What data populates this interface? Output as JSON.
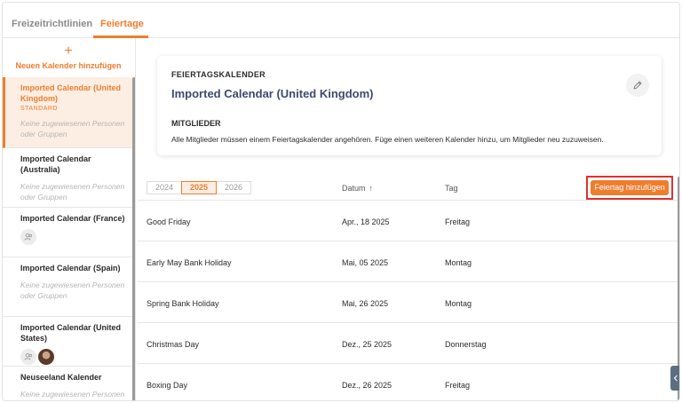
{
  "tabs": [
    {
      "label": "Freizeitrichtlinien"
    },
    {
      "label": "Feiertage"
    }
  ],
  "sidebar": {
    "add_label": "Neuen Kalender hinzufügen",
    "add_icon": "plus-icon",
    "calendars": [
      {
        "name": "Imported Calendar (United Kingdom)",
        "badge": "STANDARD",
        "members_text": "Keine zugewiesenen Personen oder Gruppen"
      },
      {
        "name": "Imported Calendar (Australia)",
        "members_text": "Keine zugewiesenen Personen oder Gruppen"
      },
      {
        "name": "Imported Calendar (France)"
      },
      {
        "name": "Imported Calendar (Spain)",
        "members_text": "Keine zugewiesenen Personen oder Gruppen"
      },
      {
        "name": "Imported Calendar (United States)"
      },
      {
        "name": "Neuseeland Kalender",
        "members_text": "Keine zugewiesenen Personen oder Gruppen"
      }
    ]
  },
  "card": {
    "heading": "FEIERTAGSKALENDER",
    "title": "Imported Calendar (United Kingdom)",
    "members_heading": "MITGLIEDER",
    "members_text": "Alle Mitglieder müssen einem Feiertagskalender angehören. Füge einen weiteren Kalender hinzu, um Mitglieder neu zuzuweisen.",
    "edit_icon": "pencil-icon"
  },
  "table": {
    "years": [
      "2024",
      "2025",
      "2026"
    ],
    "selected_year": "2025",
    "col_date": "Datum",
    "col_day": "Tag",
    "sort_icon": "arrow-up-icon",
    "add_button": "Feiertag hinzufügen",
    "rows": [
      {
        "name": "Good Friday",
        "date": "Apr., 18 2025",
        "day": "Freitag"
      },
      {
        "name": "Early May Bank Holiday",
        "date": "Mai, 05 2025",
        "day": "Montag"
      },
      {
        "name": "Spring Bank Holiday",
        "date": "Mai, 26 2025",
        "day": "Montag"
      },
      {
        "name": "Christmas Day",
        "date": "Dez., 25 2025",
        "day": "Donnerstag"
      },
      {
        "name": "Boxing Day",
        "date": "Dez., 26 2025",
        "day": "Freitag"
      }
    ]
  },
  "colors": {
    "accent": "#ef7d2e",
    "highlight": "#e03030",
    "title": "#3d4a6b"
  }
}
